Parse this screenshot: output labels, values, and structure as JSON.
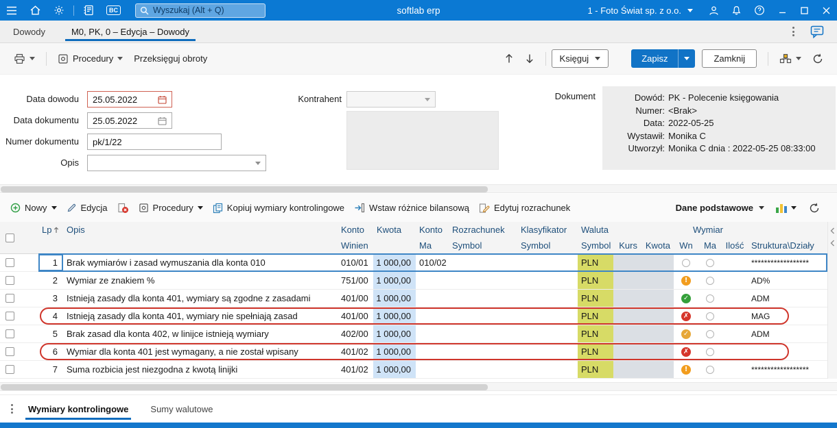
{
  "topbar": {
    "app_title": "softlab erp",
    "company_selector": "1 - Foto Świat sp. z o.o.",
    "bc_badge": "BC",
    "search": {
      "placeholder": "Wyszukaj (Alt + Q)"
    }
  },
  "tab_bar": {
    "tabs": [
      {
        "label": "Dowody"
      },
      {
        "label": "M0, PK, 0 – Edycja – Dowody"
      }
    ]
  },
  "toolbar": {
    "procedury_label": "Procedury",
    "przeksieguj_label": "Przeksięguj obroty",
    "ksieguj_label": "Księguj",
    "zapisz_label": "Zapisz",
    "zamknij_label": "Zamknij"
  },
  "form": {
    "data_dowodu": {
      "label": "Data dowodu",
      "value": "25.05.2022"
    },
    "data_dokumentu": {
      "label": "Data dokumentu",
      "value": "25.05.2022"
    },
    "numer_dokumentu": {
      "label": "Numer dokumentu",
      "value": "pk/1/22"
    },
    "opis": {
      "label": "Opis",
      "value": ""
    },
    "kontrahent": {
      "label": "Kontrahent",
      "value": ""
    },
    "dokument": {
      "label": "Dokument",
      "rows": [
        {
          "label": "Dowód:",
          "value": "PK - Polecenie księgowania"
        },
        {
          "label": "Numer:",
          "value": "<Brak>"
        },
        {
          "label": "Data:",
          "value": "2022-05-25"
        },
        {
          "label": "Wystawił:",
          "value": "Monika C"
        },
        {
          "label": "Utworzył:",
          "value": "Monika C dnia : 2022-05-25 08:33:00"
        }
      ]
    }
  },
  "grid_toolbar": {
    "nowy_label": "Nowy",
    "edycja_label": "Edycja",
    "procedury_label": "Procedury",
    "kopiuj_label": "Kopiuj wymiary kontrolingowe",
    "wstaw_label": "Wstaw różnice bilansową",
    "edytuj_label": "Edytuj rozrachunek",
    "widok_label": "Dane podstawowe"
  },
  "grid": {
    "header": {
      "lp": "Lp",
      "opis": "Opis",
      "konto": "Konto",
      "winien": "Winien",
      "kwota": "Kwota",
      "ma": "Ma",
      "rozrachunek": "Rozrachunek",
      "klasyfikator": "Klasyfikator",
      "symbol": "Symbol",
      "waluta": "Waluta",
      "kurs": "Kurs",
      "wymiar": "Wymiar",
      "wn": "Wn",
      "ilosc": "Ilość",
      "struktura": "Struktura\\Działy"
    },
    "status_icons": {
      "ok": "✓",
      "ok_warn": "✓",
      "warning": "!",
      "error": "✗",
      "empty": ""
    },
    "rows": [
      {
        "lp": "1",
        "opis": "Brak wymiarów i zasad wymuszania dla konta 010",
        "konto_winien": "010/01",
        "kwota": "1 000,00",
        "konto_ma": "010/02",
        "rozrachunek": "",
        "klasyfikator": "",
        "waluta": "PLN",
        "kurs": "",
        "kwota_waluta": "",
        "wn": "empty",
        "ma": "empty",
        "ilosc": "",
        "struktura": "******************",
        "selected": true,
        "outlined": false
      },
      {
        "lp": "2",
        "opis": "Wymiar ze znakiem %",
        "konto_winien": "751/00",
        "kwota": "1 000,00",
        "konto_ma": "",
        "rozrachunek": "",
        "klasyfikator": "",
        "waluta": "PLN",
        "kurs": "",
        "kwota_waluta": "",
        "wn": "warning",
        "ma": "empty",
        "ilosc": "",
        "struktura": "AD%",
        "selected": false,
        "outlined": false
      },
      {
        "lp": "3",
        "opis": "Istnieją zasady dla konta 401, wymiary są zgodne z zasadami",
        "konto_winien": "401/00",
        "kwota": "1 000,00",
        "konto_ma": "",
        "rozrachunek": "",
        "klasyfikator": "",
        "waluta": "PLN",
        "kurs": "",
        "kwota_waluta": "",
        "wn": "ok",
        "ma": "empty",
        "ilosc": "",
        "struktura": "ADM",
        "selected": false,
        "outlined": false
      },
      {
        "lp": "4",
        "opis": "Istnieją zasady dla konta 401, wymiary nie spełniają zasad",
        "konto_winien": "401/00",
        "kwota": "1 000,00",
        "konto_ma": "",
        "rozrachunek": "",
        "klasyfikator": "",
        "waluta": "PLN",
        "kurs": "",
        "kwota_waluta": "",
        "wn": "error",
        "ma": "empty",
        "ilosc": "",
        "struktura": "MAG",
        "selected": false,
        "outlined": true
      },
      {
        "lp": "5",
        "opis": "Brak zasad dla konta 402, w linijce istnieją wymiary",
        "konto_winien": "402/00",
        "kwota": "1 000,00",
        "konto_ma": "",
        "rozrachunek": "",
        "klasyfikator": "",
        "waluta": "PLN",
        "kurs": "",
        "kwota_waluta": "",
        "wn": "ok_warn",
        "ma": "empty",
        "ilosc": "",
        "struktura": "ADM",
        "selected": false,
        "outlined": false
      },
      {
        "lp": "6",
        "opis": "Wymiar dla konta 401 jest wymagany, a nie został wpisany",
        "konto_winien": "401/02",
        "kwota": "1 000,00",
        "konto_ma": "",
        "rozrachunek": "",
        "klasyfikator": "",
        "waluta": "PLN",
        "kurs": "",
        "kwota_waluta": "",
        "wn": "error",
        "ma": "empty",
        "ilosc": "",
        "struktura": "",
        "selected": false,
        "outlined": true
      },
      {
        "lp": "7",
        "opis": "Suma rozbicia jest niezgodna z kwotą linijki",
        "konto_winien": "401/02",
        "kwota": "1 000,00",
        "konto_ma": "",
        "rozrachunek": "",
        "klasyfikator": "",
        "waluta": "PLN",
        "kurs": "",
        "kwota_waluta": "",
        "wn": "warning",
        "ma": "empty",
        "ilosc": "",
        "struktura": "******************",
        "selected": false,
        "outlined": false
      }
    ]
  },
  "bottom_tabs": {
    "tabs": [
      {
        "label": "Wymiary kontrolingowe"
      },
      {
        "label": "Sumy walutowe"
      }
    ]
  }
}
